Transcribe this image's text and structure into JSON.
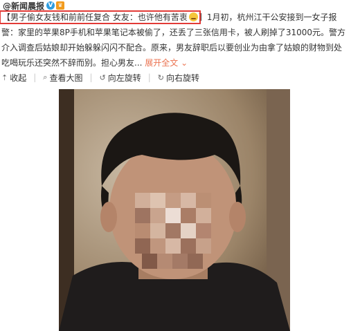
{
  "header": {
    "author": "@新闻晨报",
    "verified_icon": "verified-v-icon",
    "vip_icon": "crown-icon"
  },
  "post": {
    "highlight_text": "【男子偷女友钱和前前任复合 女友：也许他有苦衷",
    "emoji_icon": "sad-face-emoji-icon",
    "line1_rest": "】1月初，杭州江干公安接到一女子报",
    "line2": "警：家里的苹果8P手机和苹果笔记本被偷了，还丢了三张信用卡，被人刷掉了31000元。警方",
    "line3": "介入调查后姑娘却开始躲躲闪闪不配合。原来，男友辞职后以要创业为由拿了姑娘的财物到处",
    "line4": "吃喝玩乐还突然不辞而别。担心男友...",
    "expand": "展开全文",
    "expand_icon": "chevron-down-icon"
  },
  "toolbar": {
    "collapse": "收起",
    "collapse_icon": "arrow-up-icon",
    "view_large": "查看大图",
    "view_large_icon": "magnifier-icon",
    "rotate_left": "向左旋转",
    "rotate_left_icon": "rotate-left-icon",
    "rotate_right": "向右旋转",
    "rotate_right_icon": "rotate-right-icon"
  },
  "colors": {
    "highlight_border": "#e23a36",
    "link": "#eb7350",
    "text": "#333333"
  }
}
